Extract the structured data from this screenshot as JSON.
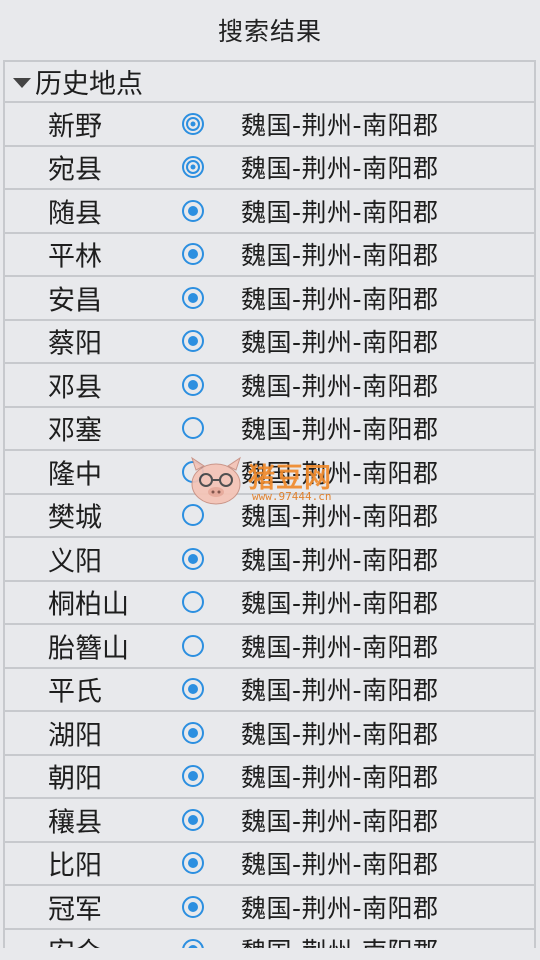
{
  "header": {
    "title": "搜索结果"
  },
  "section": {
    "title": "历史地点"
  },
  "colors": {
    "accent": "#2c8fe0",
    "separator": "#c7c9cd",
    "background": "#e8e9ec"
  },
  "rows": [
    {
      "name": "新野",
      "status": "visited-double",
      "region": "魏国-荆州-南阳郡"
    },
    {
      "name": "宛县",
      "status": "visited-double",
      "region": "魏国-荆州-南阳郡"
    },
    {
      "name": "随县",
      "status": "selected",
      "region": "魏国-荆州-南阳郡"
    },
    {
      "name": "平林",
      "status": "selected",
      "region": "魏国-荆州-南阳郡"
    },
    {
      "name": "安昌",
      "status": "selected",
      "region": "魏国-荆州-南阳郡"
    },
    {
      "name": "蔡阳",
      "status": "selected",
      "region": "魏国-荆州-南阳郡"
    },
    {
      "name": "邓县",
      "status": "selected",
      "region": "魏国-荆州-南阳郡"
    },
    {
      "name": "邓塞",
      "status": "unselected",
      "region": "魏国-荆州-南阳郡"
    },
    {
      "name": "隆中",
      "status": "unselected",
      "region": "魏国-荆州-南阳郡"
    },
    {
      "name": "樊城",
      "status": "unselected",
      "region": "魏国-荆州-南阳郡"
    },
    {
      "name": "义阳",
      "status": "selected",
      "region": "魏国-荆州-南阳郡"
    },
    {
      "name": "桐柏山",
      "status": "unselected",
      "region": "魏国-荆州-南阳郡"
    },
    {
      "name": "胎簪山",
      "status": "unselected",
      "region": "魏国-荆州-南阳郡"
    },
    {
      "name": "平氏",
      "status": "selected",
      "region": "魏国-荆州-南阳郡"
    },
    {
      "name": "湖阳",
      "status": "selected",
      "region": "魏国-荆州-南阳郡"
    },
    {
      "name": "朝阳",
      "status": "selected",
      "region": "魏国-荆州-南阳郡"
    },
    {
      "name": "穰县",
      "status": "selected",
      "region": "魏国-荆州-南阳郡"
    },
    {
      "name": "比阳",
      "status": "selected",
      "region": "魏国-荆州-南阳郡"
    },
    {
      "name": "冠军",
      "status": "selected",
      "region": "魏国-荆州-南阳郡"
    },
    {
      "name": "安众",
      "status": "selected",
      "region": "魏国-荆州-南阳郡"
    }
  ],
  "watermark": {
    "text": "猪豆网",
    "url": "www.97444.cn"
  }
}
